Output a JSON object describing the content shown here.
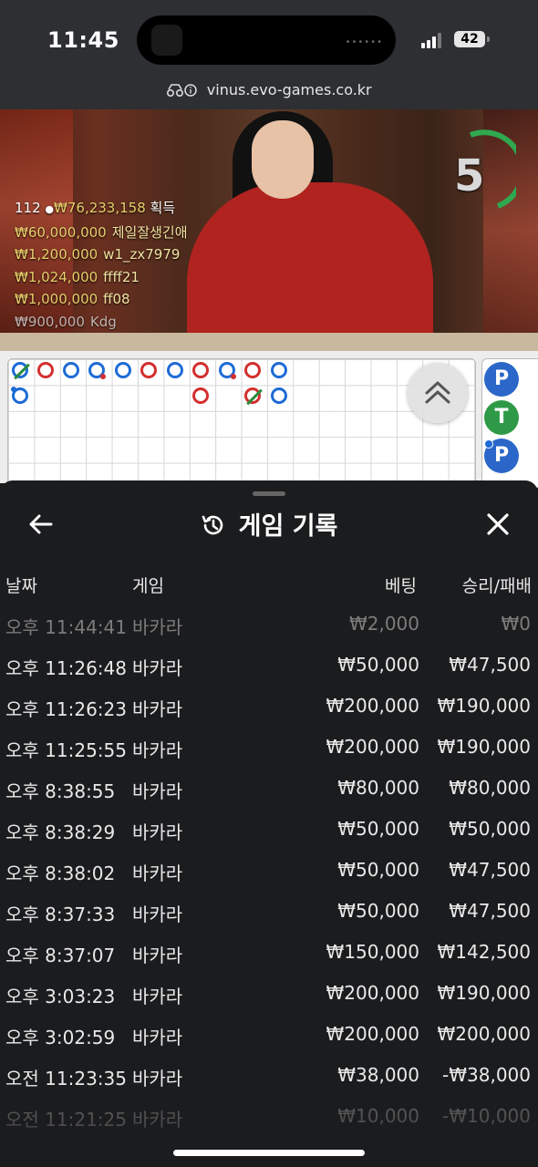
{
  "status": {
    "time": "11:45",
    "battery": "42"
  },
  "browser": {
    "url": "vinus.evo-games.co.kr"
  },
  "video": {
    "countdown": "5",
    "players_count": "112",
    "total_won": "₩76,233,158",
    "total_won_suffix": "획득",
    "winners": [
      {
        "amount": "₩60,000,000",
        "name": "제일잘생긴애"
      },
      {
        "amount": "₩1,200,000",
        "name": "w1_zx7979"
      },
      {
        "amount": "₩1,024,000",
        "name": "ffff21"
      },
      {
        "amount": "₩1,000,000",
        "name": "ff08"
      },
      {
        "amount": "₩900,000",
        "name": "Kdg"
      }
    ]
  },
  "roads": {
    "chips": [
      "P",
      "T",
      "P"
    ]
  },
  "panel": {
    "title": "게임 기록",
    "columns": {
      "date": "날짜",
      "game": "게임",
      "bet": "베팅",
      "result": "승리/패배"
    },
    "rows": [
      {
        "time": "오후 11:44:41",
        "game": "바카라",
        "bet": "₩2,000",
        "result": "₩0"
      },
      {
        "time": "오후 11:26:48",
        "game": "바카라",
        "bet": "₩50,000",
        "result": "₩47,500"
      },
      {
        "time": "오후 11:26:23",
        "game": "바카라",
        "bet": "₩200,000",
        "result": "₩190,000"
      },
      {
        "time": "오후 11:25:55",
        "game": "바카라",
        "bet": "₩200,000",
        "result": "₩190,000"
      },
      {
        "time": "오후 8:38:55",
        "game": "바카라",
        "bet": "₩80,000",
        "result": "₩80,000"
      },
      {
        "time": "오후 8:38:29",
        "game": "바카라",
        "bet": "₩50,000",
        "result": "₩50,000"
      },
      {
        "time": "오후 8:38:02",
        "game": "바카라",
        "bet": "₩50,000",
        "result": "₩47,500"
      },
      {
        "time": "오후 8:37:33",
        "game": "바카라",
        "bet": "₩50,000",
        "result": "₩47,500"
      },
      {
        "time": "오후 8:37:07",
        "game": "바카라",
        "bet": "₩150,000",
        "result": "₩142,500"
      },
      {
        "time": "오후 3:03:23",
        "game": "바카라",
        "bet": "₩200,000",
        "result": "₩190,000"
      },
      {
        "time": "오후 3:02:59",
        "game": "바카라",
        "bet": "₩200,000",
        "result": "₩200,000"
      },
      {
        "time": "오전 11:23:35",
        "game": "바카라",
        "bet": "₩38,000",
        "result": "-₩38,000"
      },
      {
        "time": "오전 11:21:25",
        "game": "바카라",
        "bet": "₩10,000",
        "result": "-₩10,000"
      }
    ]
  }
}
